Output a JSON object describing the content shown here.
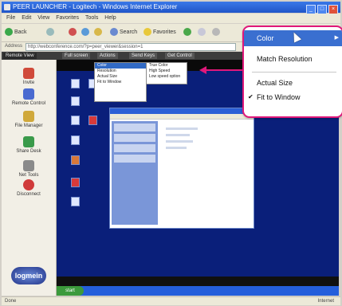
{
  "window": {
    "title": "PEER LAUNCHER - Logitech - Windows Internet Explorer"
  },
  "menubar": {
    "items": [
      "File",
      "Edit",
      "View",
      "Favorites",
      "Tools",
      "Help"
    ]
  },
  "toolbar": {
    "back_label": "Back",
    "search_label": "Search",
    "favorites_label": "Favorites"
  },
  "addressbar": {
    "label": "Address",
    "value": "http://webconference.com/?p=peer_viewer&session=1"
  },
  "viewer_tabs": [
    "Remote View",
    "Full screen",
    "Actions",
    "Send Keys",
    "Get Control"
  ],
  "sidebar": {
    "items": [
      {
        "label": "Invite",
        "color": "#d04a3a"
      },
      {
        "label": "Remote Control",
        "color": "#4a6ad0"
      },
      {
        "label": "File Manager",
        "color": "#d0a83a"
      },
      {
        "label": "Share Desk",
        "color": "#3a9a4a"
      },
      {
        "label": "Net Tools",
        "color": "#8a8a8a"
      },
      {
        "label": "Disconnect",
        "color": "#d03a3a"
      }
    ],
    "logo_text": "logmein"
  },
  "view_menu": {
    "items": [
      "Color",
      "Resolution",
      "Actual Size",
      "Fit to Window"
    ]
  },
  "color_submenu": {
    "items": [
      "True Color",
      "High Speed",
      "Low speed option"
    ]
  },
  "callout": {
    "items": [
      {
        "label": "Color",
        "highlighted": true,
        "has_submenu": true
      },
      {
        "label": "Match Resolution",
        "highlighted": false
      },
      {
        "label": "Actual Size",
        "highlighted": false
      },
      {
        "label": "Fit to Window",
        "highlighted": false,
        "checked": true
      }
    ],
    "border_color": "#e0187a",
    "highlight_color": "#3a6fd0"
  },
  "taskbar": {
    "start_label": "start"
  },
  "statusbar": {
    "text": "Done",
    "zone": "Internet"
  }
}
